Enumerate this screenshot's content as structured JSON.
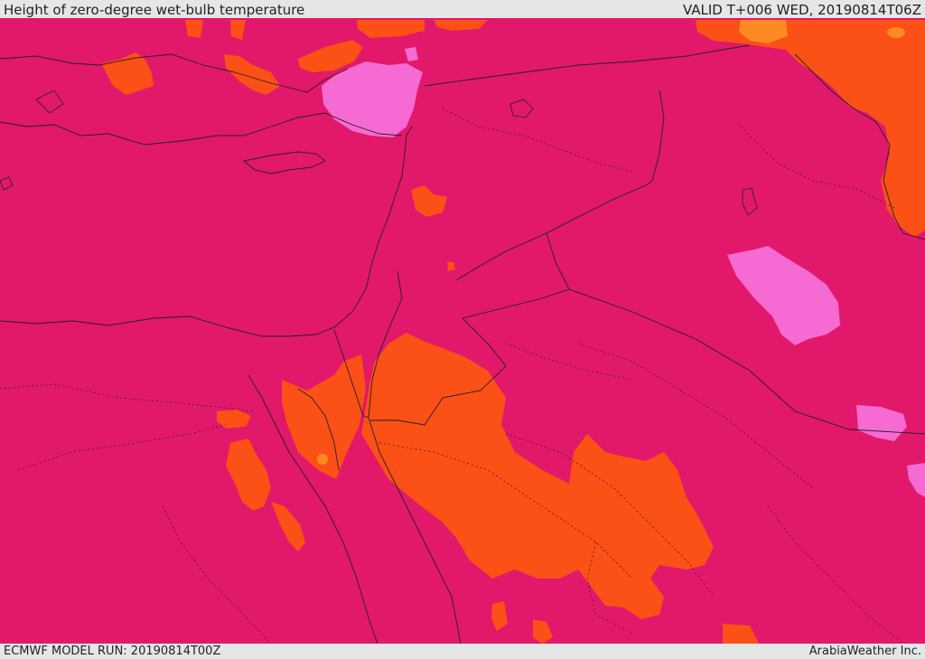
{
  "header": {
    "title": "Height of zero-degree wet-bulb temperature",
    "valid": "VALID T+006 WED, 20190814T06Z"
  },
  "footer": {
    "model_run": "ECMWF MODEL RUN: 20190814T00Z",
    "credit": "ArabiaWeather Inc."
  },
  "colors": {
    "base_magenta": "#e2186b",
    "orange": "#fb5016",
    "light_orange": "#fd8a23",
    "pink": "#f56bd3",
    "border": "#222222",
    "bar_background": "#e6e6e6"
  }
}
